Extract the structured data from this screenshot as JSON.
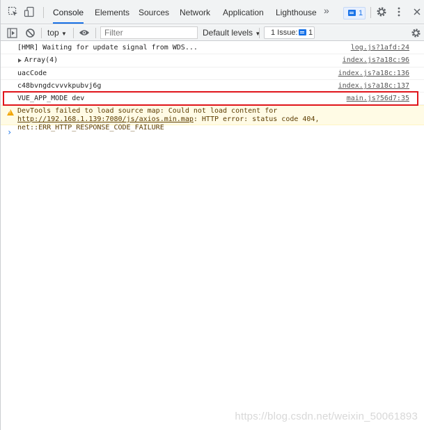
{
  "tabs": [
    {
      "label": "Console",
      "active": true
    },
    {
      "label": "Elements"
    },
    {
      "label": "Sources"
    },
    {
      "label": "Network"
    },
    {
      "label": "Application"
    },
    {
      "label": "Lighthouse"
    }
  ],
  "more_tabs_glyph": "»",
  "message_badge_count": "1",
  "toolbar": {
    "context": "top",
    "filter_placeholder": "Filter",
    "levels": "Default levels",
    "issues_label": "1 Issue:",
    "issues_count": "1"
  },
  "messages": [
    {
      "text": "[HMR] Waiting for update signal from WDS...",
      "source": "log.js?1afd:24"
    },
    {
      "text": "Array(4)",
      "source": "index.js?a18c:96",
      "expandable": true
    },
    {
      "text": "uacCode",
      "source": "index.js?a18c:136"
    },
    {
      "text": "c48bvngdcvvvkpubvj6g",
      "source": "index.js?a18c:137"
    },
    {
      "text": "VUE_APP_MODE dev",
      "source": "main.js?56d7:35",
      "highlighted": true
    }
  ],
  "warning": {
    "prefix": "DevTools failed to load source map: Could not load content for ",
    "url": "http://192.168.1.139:7080/js/axios.min.map",
    "suffix": ": HTTP error: status code 404, net::ERR_HTTP_RESPONSE_CODE_FAILURE"
  },
  "prompt_glyph": "›",
  "watermark": "https://blog.csdn.net/weixin_50061893",
  "colors": {
    "accent": "#1a73e8",
    "highlight_border": "#e0141a",
    "warning_bg": "#fffbe5"
  }
}
